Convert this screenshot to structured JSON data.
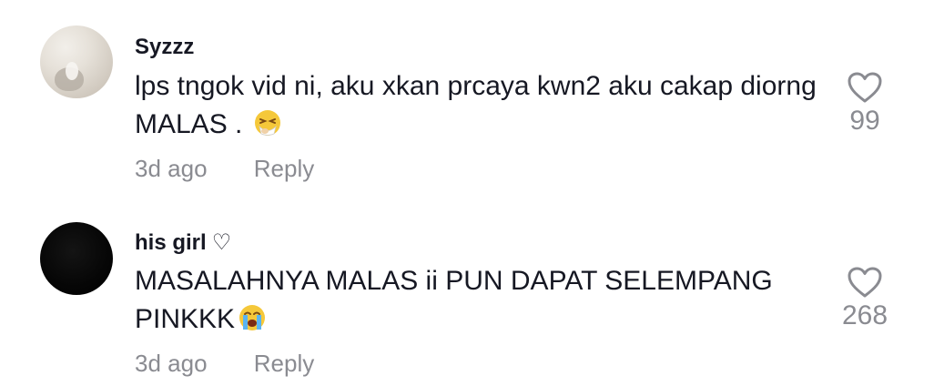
{
  "comments": [
    {
      "username": "Syzzz",
      "username_suffix": "",
      "text": "lps tngok vid ni, aku xkan prcaya kwn2 aku cakap diorng MALAS . ",
      "emoji": "sneezing-face-icon",
      "time": "3d ago",
      "reply_label": "Reply",
      "likes": "99"
    },
    {
      "username": "his girl",
      "username_suffix": "♡",
      "text": "MASALAHNYA MALAS ii PUN DAPAT SELEMPANG PINKKK",
      "emoji": "loudly-crying-face-icon",
      "time": "3d ago",
      "reply_label": "Reply",
      "likes": "268"
    }
  ],
  "colors": {
    "primary_text": "#161823",
    "secondary_text": "#8a8b91",
    "heart_outline": "#8a8b91"
  }
}
